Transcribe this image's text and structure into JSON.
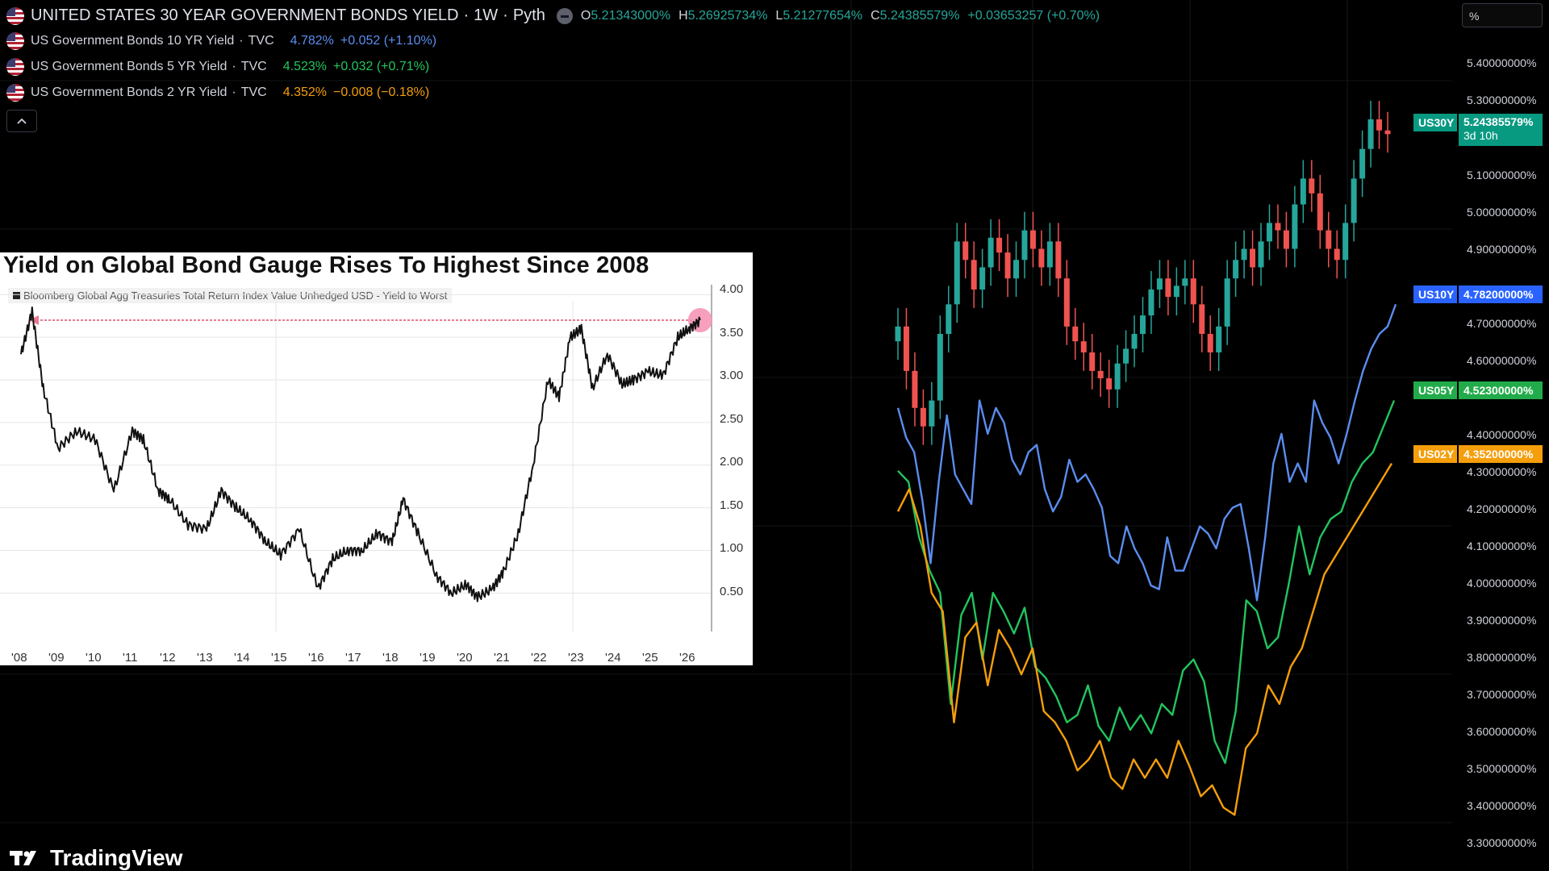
{
  "header": {
    "title": "UNITED STATES 30 YEAR GOVERNMENT BONDS YIELD",
    "interval": "1W",
    "source": "Pyth",
    "ohlc": {
      "o_label": "O",
      "o": "5.21343000%",
      "h_label": "H",
      "h": "5.26925734%",
      "l_label": "L",
      "l": "5.21277654%",
      "c_label": "C",
      "c": "5.24385579%",
      "change": "+0.03653257 (+0.70%)"
    }
  },
  "legend": [
    {
      "name": "US Government Bonds 10 YR Yield",
      "source": "TVC",
      "value": "4.782%",
      "change": "+0.052 (+1.10%)",
      "color": "#5b8def"
    },
    {
      "name": "US Government Bonds 5 YR Yield",
      "source": "TVC",
      "value": "4.523%",
      "change": "+0.032 (+0.71%)",
      "color": "#22c55e"
    },
    {
      "name": "US Government Bonds 2 YR Yield",
      "source": "TVC",
      "value": "4.352%",
      "change": "−0.008 (−0.18%)",
      "color": "#f59e0b"
    }
  ],
  "collapse_icon": "chevron-up-icon",
  "scale_mode": "%",
  "price_axis": {
    "labels": [
      "5.40000000%",
      "5.30000000%",
      "5.10000000%",
      "5.00000000%",
      "4.90000000%",
      "4.70000000%",
      "4.60000000%",
      "4.40000000%",
      "4.30000000%",
      "4.20000000%",
      "4.10000000%",
      "4.00000000%",
      "3.90000000%",
      "3.80000000%",
      "3.70000000%",
      "3.60000000%",
      "3.50000000%",
      "3.40000000%",
      "3.30000000%"
    ]
  },
  "price_tags": [
    {
      "symbol": "US30Y",
      "value": "5.24385579%",
      "countdown": "3d 10h",
      "color": "#089981"
    },
    {
      "symbol": "US10Y",
      "value": "4.78200000%",
      "color": "#2962ff"
    },
    {
      "symbol": "US05Y",
      "value": "4.52300000%",
      "color": "#22ab4a"
    },
    {
      "symbol": "US02Y",
      "value": "4.35200000%",
      "color": "#f59e0b"
    }
  ],
  "inset": {
    "title": "Yield on Global Bond Gauge Rises To Highest Since 2008",
    "legend": "Bloomberg Global Agg Treasuries Total Return Index Value Unhedged USD - Yield to Worst"
  },
  "chart_data": [
    {
      "type": "line",
      "title": "Yield on Global Bond Gauge Rises To Highest Since 2008",
      "series": [
        {
          "name": "Bloomberg Global Agg Treasuries Total Return Index Value Unhedged USD - Yield to Worst",
          "x": [
            2008,
            2008.3,
            2008.6,
            2009,
            2009.5,
            2010,
            2010.5,
            2011,
            2011.3,
            2011.7,
            2012,
            2012.5,
            2013,
            2013.4,
            2013.8,
            2014.2,
            2014.6,
            2015,
            2015.5,
            2016,
            2016.4,
            2016.8,
            2017.2,
            2017.6,
            2018,
            2018.3,
            2018.7,
            2019.2,
            2019.6,
            2020,
            2020.3,
            2020.7,
            2021,
            2021.4,
            2021.8,
            2022.2,
            2022.5,
            2022.8,
            2023.1,
            2023.4,
            2023.8,
            2024.2,
            2024.5,
            2024.9,
            2025.3,
            2025.7,
            2026,
            2026.3
          ],
          "values": [
            3.3,
            3.8,
            2.9,
            2.2,
            2.4,
            2.3,
            1.7,
            2.4,
            2.3,
            1.7,
            1.6,
            1.3,
            1.25,
            1.7,
            1.5,
            1.35,
            1.1,
            0.95,
            1.25,
            0.55,
            0.9,
            1.0,
            1.0,
            1.2,
            1.1,
            1.6,
            1.2,
            0.7,
            0.5,
            0.6,
            0.45,
            0.55,
            0.75,
            1.2,
            2.0,
            3.0,
            2.8,
            3.5,
            3.6,
            2.9,
            3.3,
            2.95,
            3.0,
            3.1,
            3.05,
            3.5,
            3.6,
            3.7
          ]
        }
      ],
      "xlabels": [
        "'08",
        "'09",
        "'10",
        "'11",
        "'12",
        "'13",
        "'14",
        "'15",
        "'16",
        "'17",
        "'18",
        "'19",
        "'20",
        "'21",
        "'22",
        "'23",
        "'24",
        "'25",
        "'26"
      ],
      "yticks": [
        "4.00",
        "3.50",
        "3.00",
        "2.50",
        "2.00",
        "1.50",
        "1.00",
        "0.50"
      ],
      "ylim": [
        0.05,
        4.05
      ],
      "grid": true,
      "annotation": "dashed arrow at highest level since 2008"
    },
    {
      "type": "line",
      "series": [
        {
          "name": "US Government Bonds 10 YR Yield",
          "color": "#5b8def",
          "values": [
            4.5,
            4.42,
            4.38,
            4.25,
            4.08,
            4.3,
            4.48,
            4.32,
            4.28,
            4.24,
            4.52,
            4.43,
            4.5,
            4.46,
            4.36,
            4.32,
            4.38,
            4.4,
            4.28,
            4.22,
            4.26,
            4.36,
            4.3,
            4.32,
            4.28,
            4.23,
            4.1,
            4.08,
            4.18,
            4.12,
            4.08,
            4.02,
            4.01,
            4.15,
            4.06,
            4.06,
            4.12,
            4.18,
            4.16,
            4.12,
            4.2,
            4.23,
            4.24,
            4.12,
            3.98,
            4.15,
            4.35,
            4.43,
            4.3,
            4.35,
            4.3,
            4.52,
            4.46,
            4.42,
            4.35,
            4.43,
            4.52,
            4.6,
            4.66,
            4.7,
            4.72,
            4.78
          ]
        },
        {
          "name": "US Government Bonds 5 YR Yield",
          "color": "#22c55e",
          "values": [
            4.33,
            4.3,
            4.15,
            4.06,
            4.0,
            3.7,
            3.94,
            4.0,
            3.82,
            4.0,
            3.95,
            3.89,
            3.96,
            3.8,
            3.77,
            3.72,
            3.65,
            3.67,
            3.75,
            3.64,
            3.6,
            3.69,
            3.63,
            3.67,
            3.62,
            3.7,
            3.67,
            3.79,
            3.82,
            3.76,
            3.6,
            3.54,
            3.68,
            3.98,
            3.95,
            3.85,
            3.88,
            4.02,
            4.18,
            4.05,
            4.15,
            4.2,
            4.22,
            4.3,
            4.35,
            4.38,
            4.45,
            4.52
          ]
        },
        {
          "name": "US Government Bonds 2 YR Yield",
          "color": "#f59e0b",
          "values": [
            4.22,
            4.28,
            4.18,
            4.0,
            3.95,
            3.65,
            3.88,
            3.92,
            3.75,
            3.9,
            3.85,
            3.78,
            3.85,
            3.68,
            3.65,
            3.6,
            3.52,
            3.55,
            3.6,
            3.5,
            3.47,
            3.55,
            3.5,
            3.55,
            3.5,
            3.6,
            3.53,
            3.45,
            3.48,
            3.42,
            3.4,
            3.58,
            3.62,
            3.75,
            3.7,
            3.8,
            3.85,
            3.95,
            4.05,
            4.1,
            4.15,
            4.2,
            4.25,
            4.3,
            4.35
          ]
        }
      ],
      "candles_symbol": "US30Y",
      "ylim": [
        3.27,
        5.45
      ]
    }
  ]
}
